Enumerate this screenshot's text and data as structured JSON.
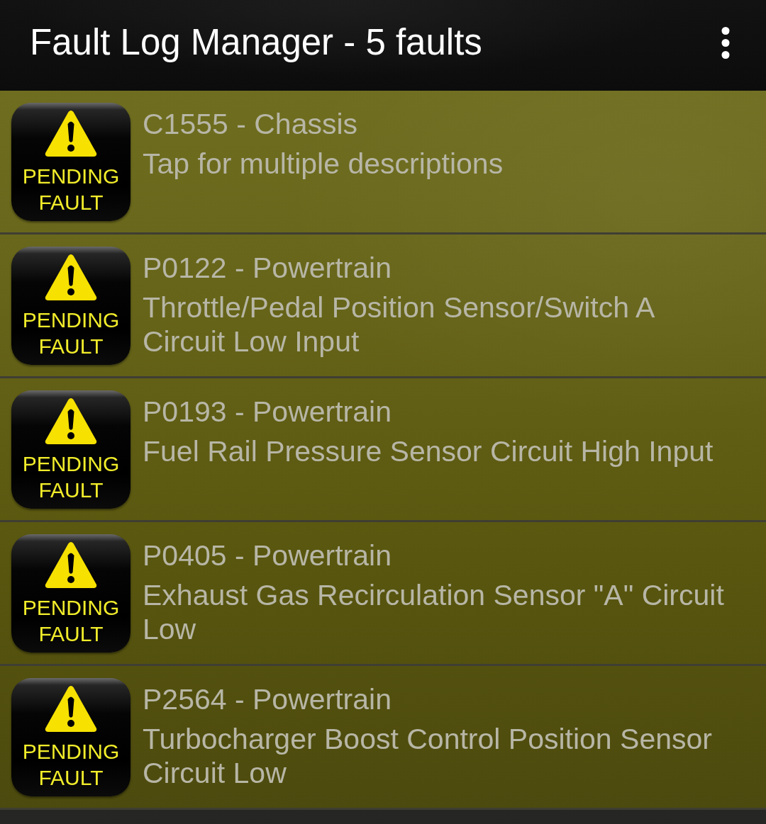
{
  "app_bar": {
    "title": "Fault Log Manager - 5 faults"
  },
  "faults": [
    {
      "badge": "PENDING FAULT",
      "title": "C1555 - Chassis",
      "description": "Tap for multiple descriptions"
    },
    {
      "badge": "PENDING FAULT",
      "title": "P0122 - Powertrain",
      "description": "Throttle/Pedal Position Sensor/Switch A Circuit Low Input"
    },
    {
      "badge": "PENDING FAULT",
      "title": "P0193 - Powertrain",
      "description": "Fuel Rail Pressure Sensor Circuit High Input"
    },
    {
      "badge": "PENDING FAULT",
      "title": "P0405 - Powertrain",
      "description": "Exhaust Gas Recirculation Sensor \"A\" Circuit Low"
    },
    {
      "badge": "PENDING FAULT",
      "title": "P2564 - Powertrain",
      "description": "Turbocharger Boost Control Position Sensor Circuit Low"
    }
  ]
}
